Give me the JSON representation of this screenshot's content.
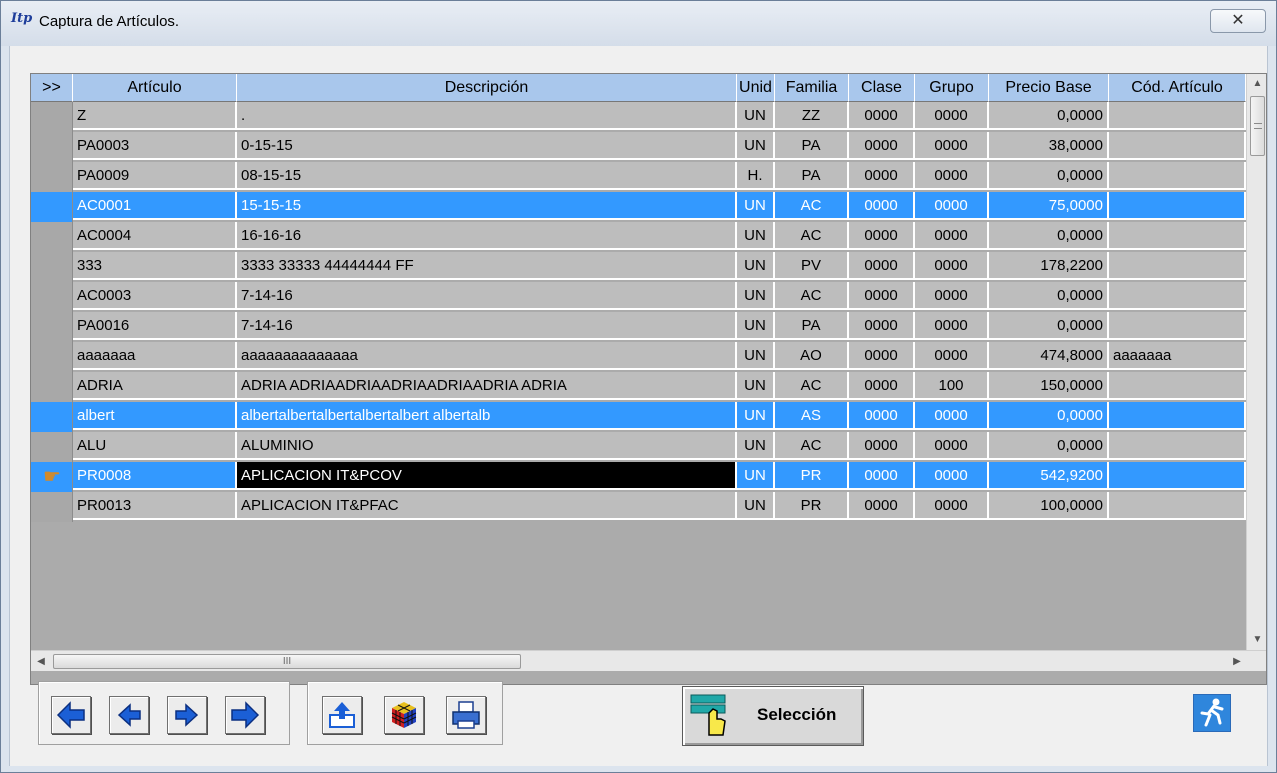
{
  "window": {
    "title": "Captura de Artículos.",
    "logo_text": "Itp",
    "close_glyph": "✕"
  },
  "grid": {
    "indicator_header": ">>",
    "columns": [
      "Artículo",
      "Descripción",
      "Unid",
      "Familia",
      "Clase",
      "Grupo",
      "Precio Base",
      "Cód. Artículo"
    ],
    "rows": [
      {
        "articulo": "Z",
        "descripcion": ".",
        "unidad": "UN",
        "familia": "ZZ",
        "clase": "0000",
        "grupo": "0000",
        "precio": "0,0000",
        "cod": "",
        "selected": false
      },
      {
        "articulo": "PA0003",
        "descripcion": "0-15-15",
        "unidad": "UN",
        "familia": "PA",
        "clase": "0000",
        "grupo": "0000",
        "precio": "38,0000",
        "cod": "",
        "selected": false
      },
      {
        "articulo": "PA0009",
        "descripcion": "08-15-15",
        "unidad": "H.",
        "familia": "PA",
        "clase": "0000",
        "grupo": "0000",
        "precio": "0,0000",
        "cod": "",
        "selected": false
      },
      {
        "articulo": "AC0001",
        "descripcion": "15-15-15",
        "unidad": "UN",
        "familia": "AC",
        "clase": "0000",
        "grupo": "0000",
        "precio": "75,0000",
        "cod": "",
        "selected": true
      },
      {
        "articulo": "AC0004",
        "descripcion": "16-16-16",
        "unidad": "UN",
        "familia": "AC",
        "clase": "0000",
        "grupo": "0000",
        "precio": "0,0000",
        "cod": "",
        "selected": false
      },
      {
        "articulo": "333",
        "descripcion": "3333 33333 44444444 FF",
        "unidad": "UN",
        "familia": "PV",
        "clase": "0000",
        "grupo": "0000",
        "precio": "178,2200",
        "cod": "",
        "selected": false
      },
      {
        "articulo": "AC0003",
        "descripcion": "7-14-16",
        "unidad": "UN",
        "familia": "AC",
        "clase": "0000",
        "grupo": "0000",
        "precio": "0,0000",
        "cod": "",
        "selected": false
      },
      {
        "articulo": "PA0016",
        "descripcion": "7-14-16",
        "unidad": "UN",
        "familia": "PA",
        "clase": "0000",
        "grupo": "0000",
        "precio": "0,0000",
        "cod": "",
        "selected": false
      },
      {
        "articulo": "aaaaaaa",
        "descripcion": "aaaaaaaaaaaaaa",
        "unidad": "UN",
        "familia": "AO",
        "clase": "0000",
        "grupo": "0000",
        "precio": "474,8000",
        "cod": "aaaaaaa",
        "selected": false
      },
      {
        "articulo": "ADRIA",
        "descripcion": "ADRIA ADRIAADRIAADRIAADRIAADRIA ADRIA",
        "unidad": "UN",
        "familia": "AC",
        "clase": "0000",
        "grupo": "100",
        "precio": "150,0000",
        "cod": "",
        "selected": false
      },
      {
        "articulo": "albert",
        "descripcion": "albertalbertalbertalbertalbert albertalb",
        "unidad": "UN",
        "familia": "AS",
        "clase": "0000",
        "grupo": "0000",
        "precio": "0,0000",
        "cod": "",
        "selected": true
      },
      {
        "articulo": "ALU",
        "descripcion": "ALUMINIO",
        "unidad": "UN",
        "familia": "AC",
        "clase": "0000",
        "grupo": "0000",
        "precio": "0,0000",
        "cod": "",
        "selected": false
      },
      {
        "articulo": "PR0008",
        "descripcion": "APLICACION IT&PCOV",
        "unidad": "UN",
        "familia": "PR",
        "clase": "0000",
        "grupo": "0000",
        "precio": "542,9200",
        "cod": "",
        "selected": true,
        "current": true
      },
      {
        "articulo": "PR0013",
        "descripcion": "APLICACION IT&PFAC",
        "unidad": "UN",
        "familia": "PR",
        "clase": "0000",
        "grupo": "0000",
        "precio": "100,0000",
        "cod": "",
        "selected": false
      }
    ]
  },
  "scrollbar": {
    "h_thumb_glyph": "III",
    "up": "▲",
    "down": "▼",
    "left": "◀",
    "right": "▶"
  },
  "toolbar": {
    "nav_icons": [
      "arrow-first-icon",
      "arrow-prev-icon",
      "arrow-next-icon",
      "arrow-last-icon"
    ],
    "tool_icons": [
      "upload-icon",
      "rubik-cube-icon",
      "printer-icon"
    ],
    "selection_label": "Selección",
    "exit_icon": "runner-exit-icon"
  },
  "colors": {
    "selection": "#3399ff",
    "header": "#a9c7ec",
    "arrow_blue": "#1b5fd6"
  }
}
